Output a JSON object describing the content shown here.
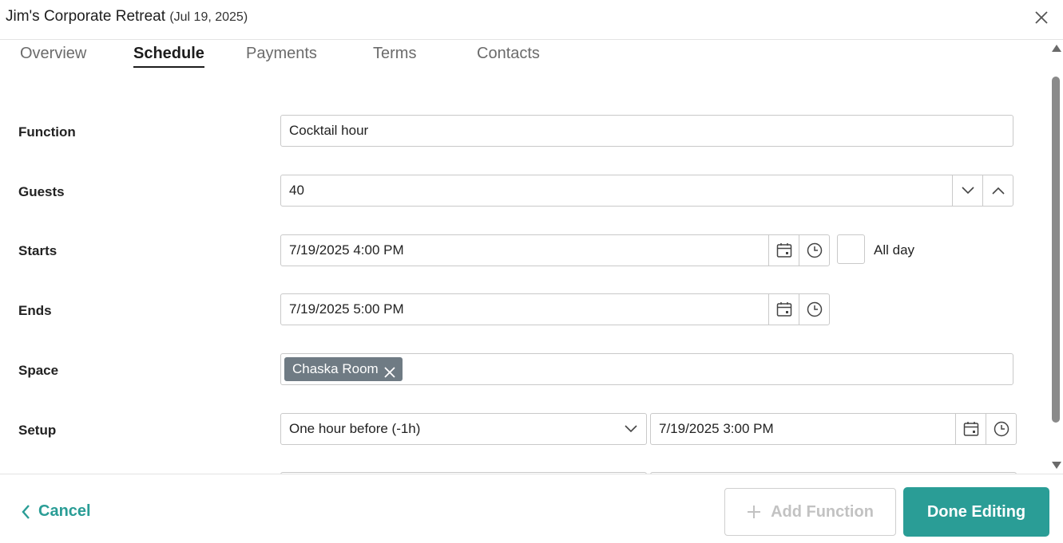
{
  "header": {
    "title": "Jim's Corporate Retreat",
    "date": "(Jul 19, 2025)"
  },
  "tabs": [
    {
      "label": "Overview",
      "active": false
    },
    {
      "label": "Schedule",
      "active": true
    },
    {
      "label": "Payments",
      "active": false
    },
    {
      "label": "Terms",
      "active": false
    },
    {
      "label": "Contacts",
      "active": false
    }
  ],
  "form": {
    "function": {
      "label": "Function",
      "value": "Cocktail hour"
    },
    "guests": {
      "label": "Guests",
      "value": "40"
    },
    "starts": {
      "label": "Starts",
      "value": "7/19/2025 4:00 PM",
      "all_day_label": "All day",
      "all_day_checked": false
    },
    "ends": {
      "label": "Ends",
      "value": "7/19/2025 5:00 PM"
    },
    "space": {
      "label": "Space",
      "chips": [
        "Chaska Room"
      ]
    },
    "setup": {
      "label": "Setup",
      "offset_value": "One hour before (-1h)",
      "value": "7/19/2025 3:00 PM"
    }
  },
  "footer": {
    "cancel_label": "Cancel",
    "add_function_label": "Add Function",
    "done_label": "Done Editing"
  },
  "icons": {
    "close": "close-icon",
    "calendar": "calendar-icon",
    "clock": "clock-icon",
    "chevron_down": "chevron-down-icon",
    "chevron_up": "chevron-up-icon",
    "chevron_left": "chevron-left-icon",
    "plus": "plus-icon",
    "remove": "remove-chip-icon"
  },
  "colors": {
    "accent": "#2a9d96",
    "chip": "#6f7b84",
    "border": "#c9c9c9",
    "disabled_text": "#c2c2c2"
  }
}
